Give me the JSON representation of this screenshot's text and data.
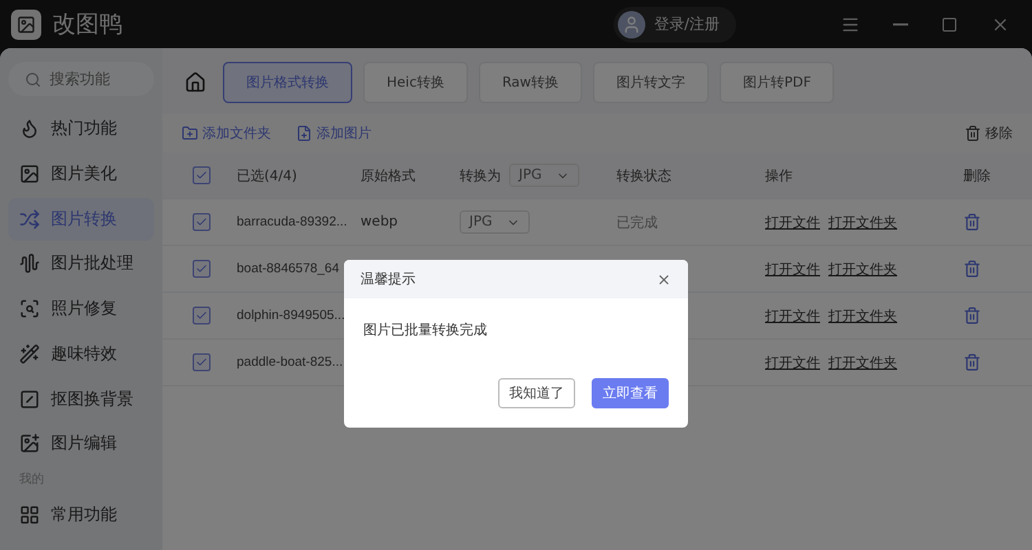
{
  "app": {
    "title": "改图鸭",
    "login": "登录/注册"
  },
  "search": {
    "placeholder": "搜索功能"
  },
  "sidebar": {
    "items": [
      {
        "label": "热门功能",
        "selected": false
      },
      {
        "label": "图片美化",
        "selected": false
      },
      {
        "label": "图片转换",
        "selected": true
      },
      {
        "label": "图片批处理",
        "selected": false
      },
      {
        "label": "照片修复",
        "selected": false
      },
      {
        "label": "趣味特效",
        "selected": false
      },
      {
        "label": "抠图换背景",
        "selected": false
      },
      {
        "label": "图片编辑",
        "selected": false
      }
    ],
    "section": "我的",
    "more": [
      {
        "label": "常用功能",
        "selected": false
      }
    ]
  },
  "tabs": [
    {
      "label": "图片格式转换",
      "selected": true
    },
    {
      "label": "Heic转换",
      "selected": false
    },
    {
      "label": "Raw转换",
      "selected": false
    },
    {
      "label": "图片转文字",
      "selected": false
    },
    {
      "label": "图片转PDF",
      "selected": false
    }
  ],
  "toolbar": {
    "add_folder": "添加文件夹",
    "add_image": "添加图片",
    "remove": "移除"
  },
  "table": {
    "all_checked": true,
    "columns": [
      "已选(4/4)",
      "原始格式",
      "转换为",
      "转换状态",
      "操作",
      "删除"
    ],
    "convert_to": "JPG",
    "rows": [
      {
        "checked": true,
        "name": "barracuda-89392...",
        "format": "webp",
        "target": "JPG",
        "status": "已完成",
        "open_file": "打开文件",
        "open_folder": "打开文件夹"
      },
      {
        "checked": true,
        "name": "boat-8846578_64",
        "open_file": "打开文件",
        "open_folder": "打开文件夹"
      },
      {
        "checked": true,
        "name": "dolphin-8949505...",
        "open_file": "打开文件",
        "open_folder": "打开文件夹"
      },
      {
        "checked": true,
        "name": "paddle-boat-825...",
        "open_file": "打开文件",
        "open_folder": "打开文件夹"
      }
    ]
  },
  "dialog": {
    "title": "温馨提示",
    "message": "图片已批量转换完成",
    "buttons": [
      {
        "label": "我知道了",
        "kind": "secondary"
      },
      {
        "label": "立即查看",
        "kind": "primary"
      }
    ]
  }
}
